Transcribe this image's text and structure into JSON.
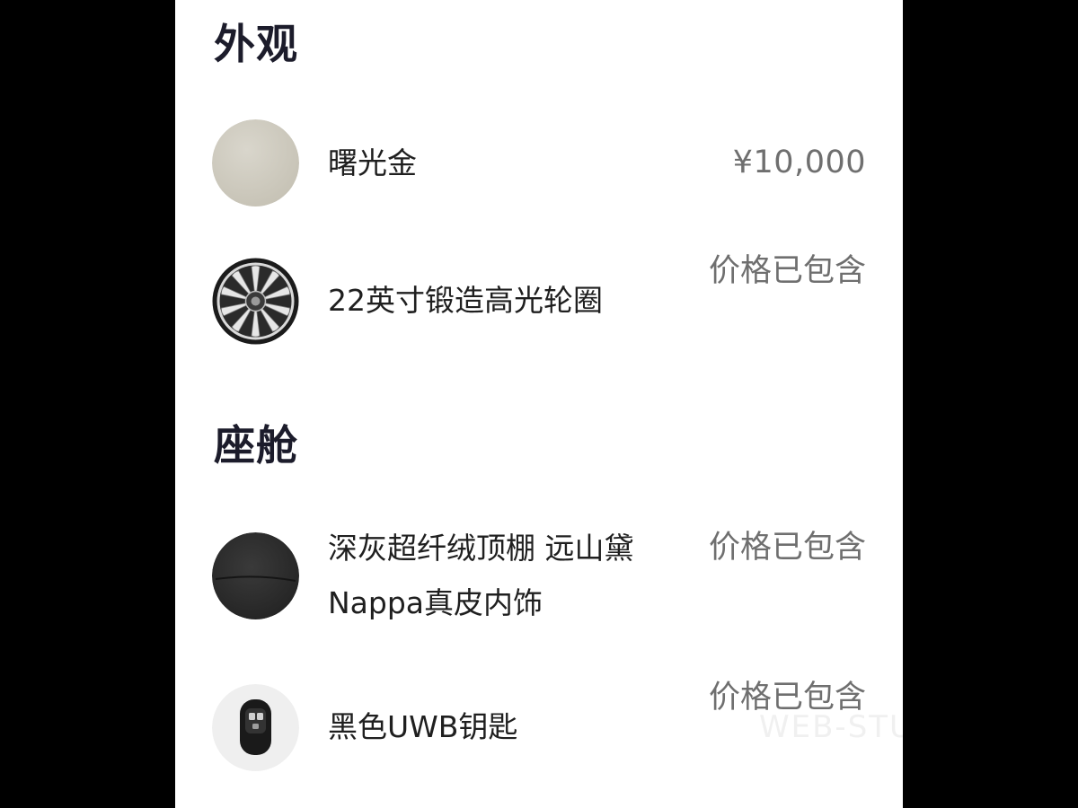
{
  "sections": {
    "exterior": {
      "title": "外观",
      "items": [
        {
          "name": "曙光金",
          "price": "¥10,000",
          "icon": "paint-swatch-icon"
        },
        {
          "name": "22英寸锻造高光轮圈",
          "price": "价格已包含",
          "icon": "wheel-rim-icon"
        }
      ]
    },
    "cabin": {
      "title": "座舱",
      "items": [
        {
          "name": "深灰超纤绒顶棚 远山黛Nappa真皮内饰",
          "price": "价格已包含",
          "icon": "interior-leather-icon"
        },
        {
          "name": "黑色UWB钥匙",
          "price": "价格已包含",
          "icon": "car-key-icon"
        }
      ]
    }
  },
  "watermark": "WEB-STUDIO",
  "colors": {
    "gold_swatch": "#cfcbbf",
    "leather_swatch": "#2e2e2e",
    "key_body": "#1a1a1a",
    "page_bg": "#ffffff",
    "outer_bg": "#000000"
  }
}
